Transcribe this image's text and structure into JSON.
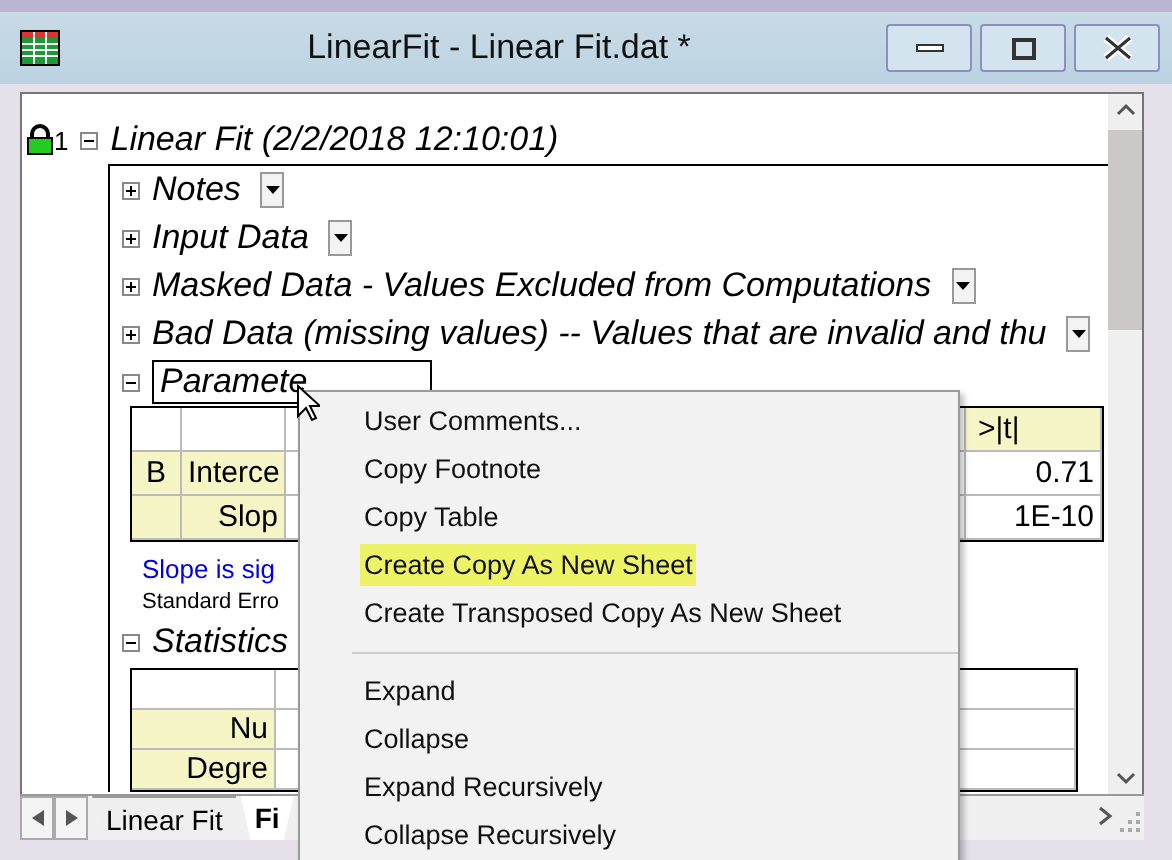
{
  "window": {
    "title": "LinearFit - Linear Fit.dat *"
  },
  "report": {
    "index": "1",
    "title": "Linear Fit (2/2/2018 12:10:01)",
    "expanded": true,
    "sections": [
      {
        "kind": "node",
        "label": "Notes",
        "expanded": false
      },
      {
        "kind": "node",
        "label": "Input Data",
        "expanded": false
      },
      {
        "kind": "node",
        "label": "Masked Data - Values Excluded from Computations",
        "expanded": false
      },
      {
        "kind": "node",
        "label": "Bad Data (missing values) -- Values that are invalid and thu",
        "expanded": false
      },
      {
        "kind": "table",
        "label": "Paramete",
        "expanded": true,
        "header": ">|t|",
        "group": "B",
        "rows": [
          {
            "name": "Interce",
            "value": "0.71"
          },
          {
            "name": "Slop",
            "value": "1E-10"
          }
        ],
        "note": "Slope is sig",
        "footnote": "Standard Erro"
      },
      {
        "kind": "stats",
        "label": "Statistics",
        "expanded": true,
        "rows": [
          {
            "name": "Nu"
          },
          {
            "name": "Degre"
          }
        ]
      }
    ]
  },
  "tabs": [
    {
      "label": "Linear Fit",
      "selected": false
    },
    {
      "label": "Fi",
      "selected": true
    }
  ],
  "context_menu": [
    {
      "kind": "item",
      "label": "User Comments...",
      "selected": false
    },
    {
      "kind": "item",
      "label": "Copy Footnote",
      "selected": false
    },
    {
      "kind": "item",
      "label": "Copy Table",
      "selected": false
    },
    {
      "kind": "item",
      "label": "Create Copy As New Sheet",
      "selected": true
    },
    {
      "kind": "item",
      "label": "Create Transposed Copy As New Sheet",
      "selected": false
    },
    {
      "kind": "separator"
    },
    {
      "kind": "item",
      "label": "Expand",
      "selected": false
    },
    {
      "kind": "item",
      "label": "Collapse",
      "selected": false
    },
    {
      "kind": "item",
      "label": "Expand Recursively",
      "selected": false
    },
    {
      "kind": "item",
      "label": "Collapse Recursively",
      "selected": false
    }
  ]
}
